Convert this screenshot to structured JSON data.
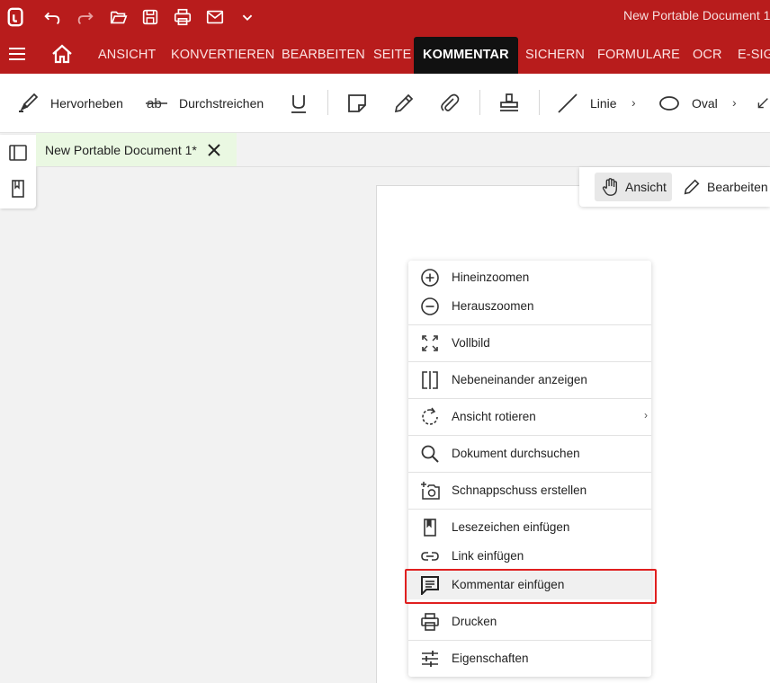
{
  "titlebar": {
    "doc_title": "New Portable Document 1"
  },
  "ribbon": {
    "tabs": [
      "ANSICHT",
      "KONVERTIEREN",
      "BEARBEITEN",
      "SEITE",
      "KOMMENTAR",
      "SICHERN",
      "FORMULARE",
      "OCR",
      "E-SIG"
    ],
    "active_tab": "KOMMENTAR"
  },
  "toolbar": {
    "highlight": "Hervorheben",
    "strike": "Durchstreichen",
    "line": "Linie",
    "oval": "Oval"
  },
  "doc_tab": {
    "label": "New Portable Document 1*"
  },
  "mode": {
    "view": "Ansicht",
    "edit": "Bearbeiten"
  },
  "context_menu": {
    "items": [
      {
        "label": "Hineinzoomen",
        "icon": "zoom-in-icon"
      },
      {
        "label": "Herauszoomen",
        "icon": "zoom-out-icon"
      },
      {
        "label": "Vollbild",
        "icon": "fullscreen-icon"
      },
      {
        "label": "Nebeneinander anzeigen",
        "icon": "side-by-side-icon"
      },
      {
        "label": "Ansicht rotieren",
        "icon": "rotate-icon",
        "submenu": true
      },
      {
        "label": "Dokument durchsuchen",
        "icon": "search-icon"
      },
      {
        "label": "Schnappschuss erstellen",
        "icon": "snapshot-icon"
      },
      {
        "label": "Lesezeichen einfügen",
        "icon": "bookmark-icon"
      },
      {
        "label": "Link einfügen",
        "icon": "link-icon"
      },
      {
        "label": "Kommentar einfügen",
        "icon": "comment-icon",
        "highlighted": true
      },
      {
        "label": "Drucken",
        "icon": "print-icon"
      },
      {
        "label": "Eigenschaften",
        "icon": "properties-icon"
      }
    ]
  },
  "colors": {
    "brand_red": "#b81c1c",
    "active_tab_bg": "#111111",
    "doc_tab_bg": "#eaf8e2",
    "highlight_box": "#e01f1f"
  }
}
